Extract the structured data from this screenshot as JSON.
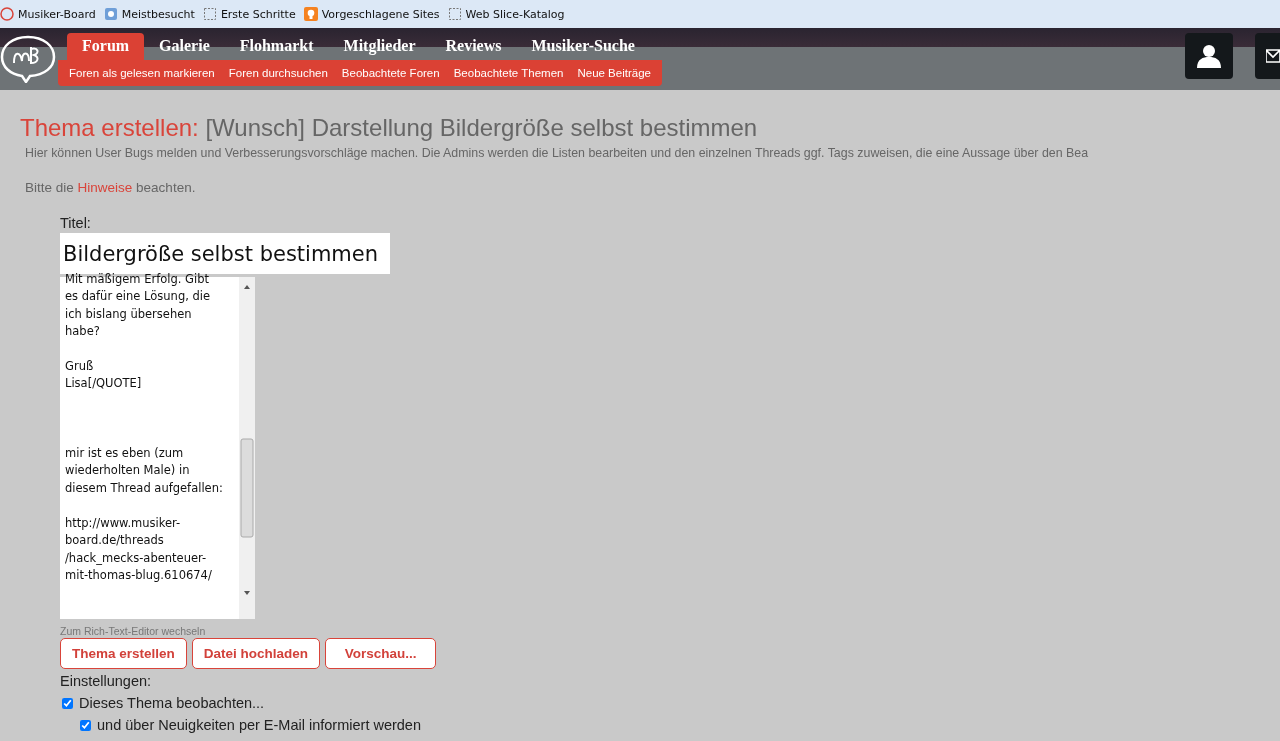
{
  "bookmarks": [
    {
      "label": "Musiker-Board",
      "kind": "site"
    },
    {
      "label": "Meistbesucht",
      "kind": "page"
    },
    {
      "label": "Erste Schritte",
      "kind": "slice"
    },
    {
      "label": "Vorgeschlagene Sites",
      "kind": "bulb"
    },
    {
      "label": "Web Slice-Katalog",
      "kind": "slice"
    }
  ],
  "nav": {
    "tabs": [
      {
        "label": "Forum",
        "selected": true
      },
      {
        "label": "Galerie",
        "selected": false
      },
      {
        "label": "Flohmarkt",
        "selected": false
      },
      {
        "label": "Mitglieder",
        "selected": false
      },
      {
        "label": "Reviews",
        "selected": false
      },
      {
        "label": "Musiker-Suche",
        "selected": false
      }
    ],
    "subnav": [
      "Foren als gelesen markieren",
      "Foren durchsuchen",
      "Beobachtete Foren",
      "Beobachtete Themen",
      "Neue Beiträge"
    ]
  },
  "heading": {
    "prefix": "Thema erstellen:",
    "title": "[Wunsch] Darstellung Bildergröße selbst bestimmen"
  },
  "description": "Hier können User Bugs melden und Verbesserungsvorschläge machen. Die Admins werden die Listen bearbeiten und den einzelnen Threads ggf. Tags zuweisen, die eine Aussage über den Bea",
  "hint": {
    "before": "Bitte die",
    "link": "Hinweise",
    "after": "beachten."
  },
  "form": {
    "title_label": "Titel:",
    "title_value": "Bildergröße selbst bestimmen",
    "message": "Mit mäßigem Erfolg. Gibt\nes dafür eine Lösung, die\nich bislang übersehen\nhabe?\n\nGruß\nLisa[/QUOTE]\n\n\n\nmir ist es eben (zum\nwiederholten Male) in\ndiesem Thread aufgefallen:\n\nhttp://www.musiker-\nboard.de/threads\n/hack_mecks-abenteuer-\nmit-thomas-blug.610674/",
    "editor_switch": "Zum Rich-Text-Editor wechseln",
    "buttons": [
      "Thema erstellen",
      "Datei hochladen",
      "Vorschau..."
    ],
    "settings_label": "Einstellungen:",
    "options": [
      {
        "label": "Dieses Thema beobachten...",
        "checked": true,
        "children": [
          {
            "label": "und über Neuigkeiten per E-Mail informiert werden",
            "checked": true
          }
        ]
      }
    ]
  }
}
